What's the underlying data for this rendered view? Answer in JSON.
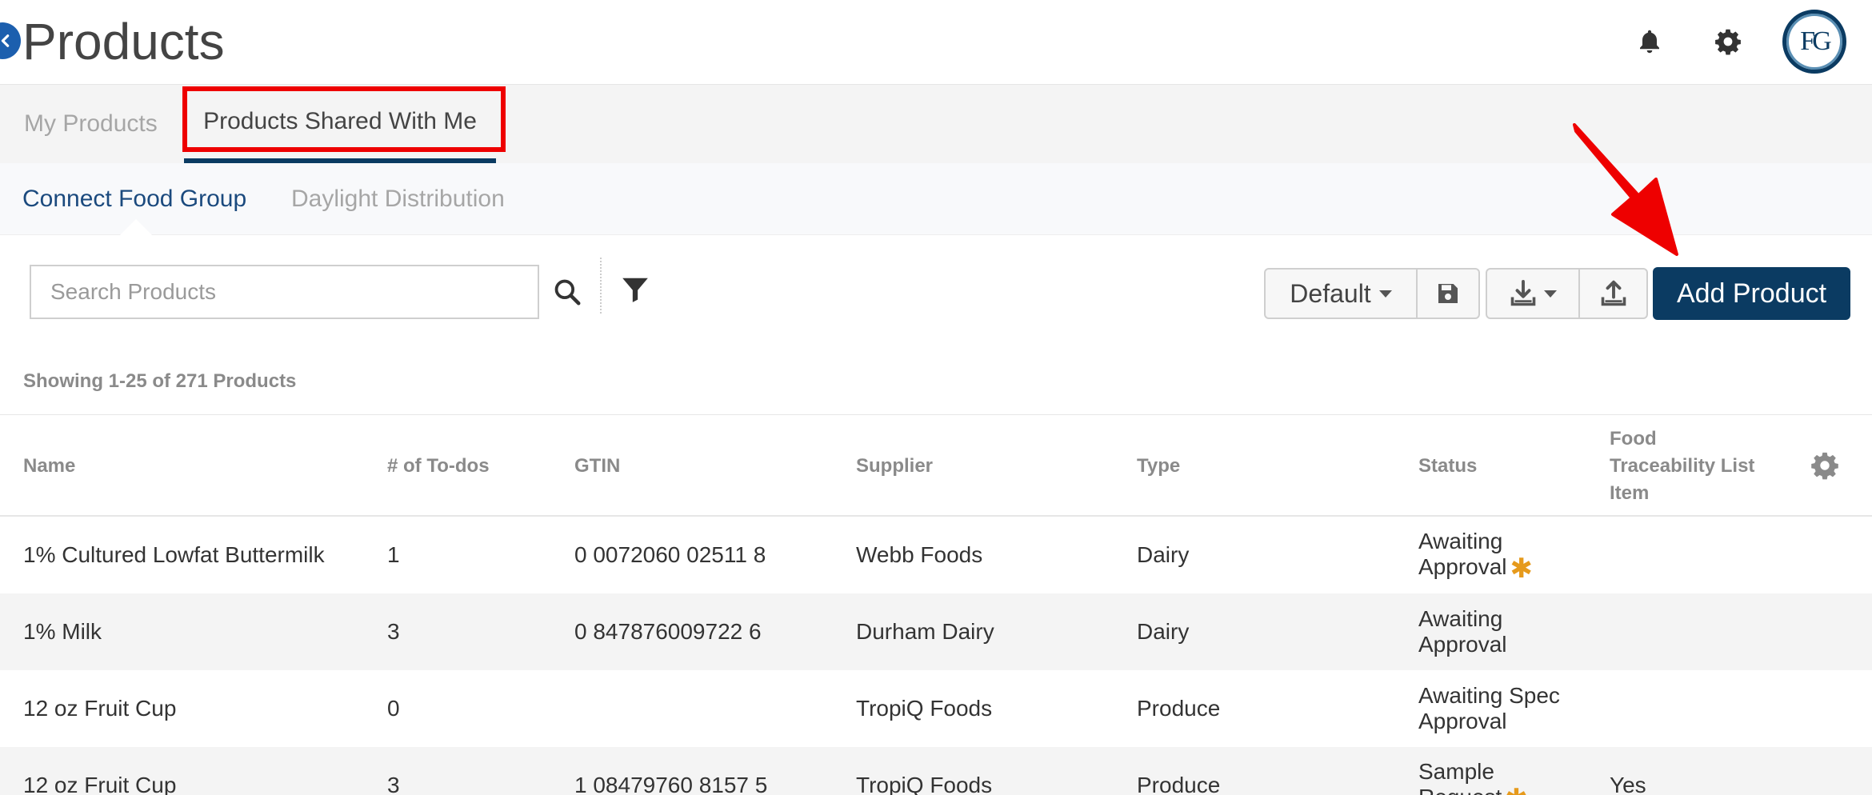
{
  "header": {
    "title": "Products",
    "avatar_initials": "FG"
  },
  "tabs": {
    "my_products": "My Products",
    "shared_with_me": "Products Shared With Me"
  },
  "subtabs": {
    "connect_food_group": "Connect Food Group",
    "daylight_distribution": "Daylight Distribution"
  },
  "toolbar": {
    "search_placeholder": "Search Products",
    "view_label": "Default",
    "add_product": "Add Product"
  },
  "result_count": "Showing 1-25 of 271 Products",
  "table": {
    "headers": {
      "name": "Name",
      "todos": "# of To-dos",
      "gtin": "GTIN",
      "supplier": "Supplier",
      "type": "Type",
      "status": "Status",
      "ftl_1": "Food",
      "ftl_2": "Traceability List",
      "ftl_3": "Item"
    },
    "rows": [
      {
        "name": "1% Cultured Lowfat Buttermilk",
        "todos": "1",
        "gtin": "0 0072060 02511 8",
        "supplier": "Webb Foods",
        "type": "Dairy",
        "status_1": "Awaiting",
        "status_2": "Approval",
        "ftl": ""
      },
      {
        "name": "1% Milk",
        "todos": "3",
        "gtin": "0 847876009722 6",
        "supplier": "Durham Dairy",
        "type": "Dairy",
        "status_1": "Awaiting",
        "status_2": "Approval",
        "ftl": ""
      },
      {
        "name": "12 oz Fruit Cup",
        "todos": "0",
        "gtin": "",
        "supplier": "TropiQ Foods",
        "type": "Produce",
        "status_1": "Awaiting Spec",
        "status_2": "Approval",
        "ftl": ""
      },
      {
        "name": "12 oz Fruit Cup",
        "todos": "3",
        "gtin": "1 08479760 8157 5",
        "supplier": "TropiQ Foods",
        "type": "Produce",
        "status_1": "Sample",
        "status_2": "Request",
        "ftl": "Yes"
      }
    ]
  },
  "colors": {
    "brand_navy": "#0b3b62",
    "link_blue": "#1b4a7e",
    "highlight_red": "#ee0000",
    "star_orange": "#e69a1c"
  }
}
